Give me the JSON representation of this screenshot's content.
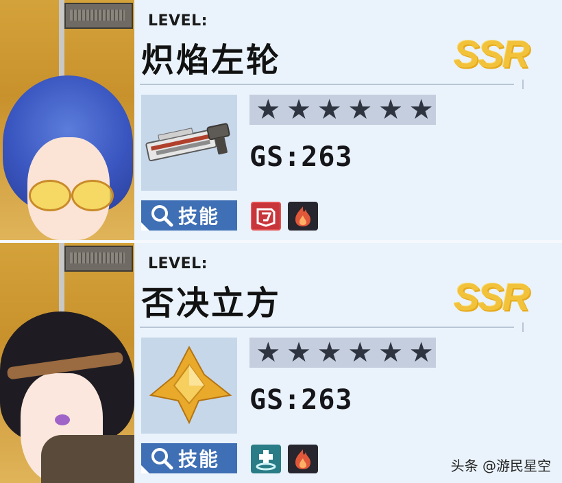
{
  "cards": [
    {
      "level_label": "LEVEL:",
      "name": "炽焰左轮",
      "rarity": "SSR",
      "gs": "GS:263",
      "stars": 6,
      "skill_label": "技能",
      "element_icons": [
        "shield-icon",
        "fire-icon"
      ]
    },
    {
      "level_label": "LEVEL:",
      "name": "否决立方",
      "rarity": "SSR",
      "gs": "GS:263",
      "stars": 6,
      "skill_label": "技能",
      "element_icons": [
        "heal-icon",
        "fire-icon"
      ]
    }
  ],
  "watermark": "头条 @游民星空",
  "colors": {
    "rarity_gold": "#f2c23b",
    "skill_button": "#3f6fb4",
    "stars_bar": "#c5cede"
  }
}
